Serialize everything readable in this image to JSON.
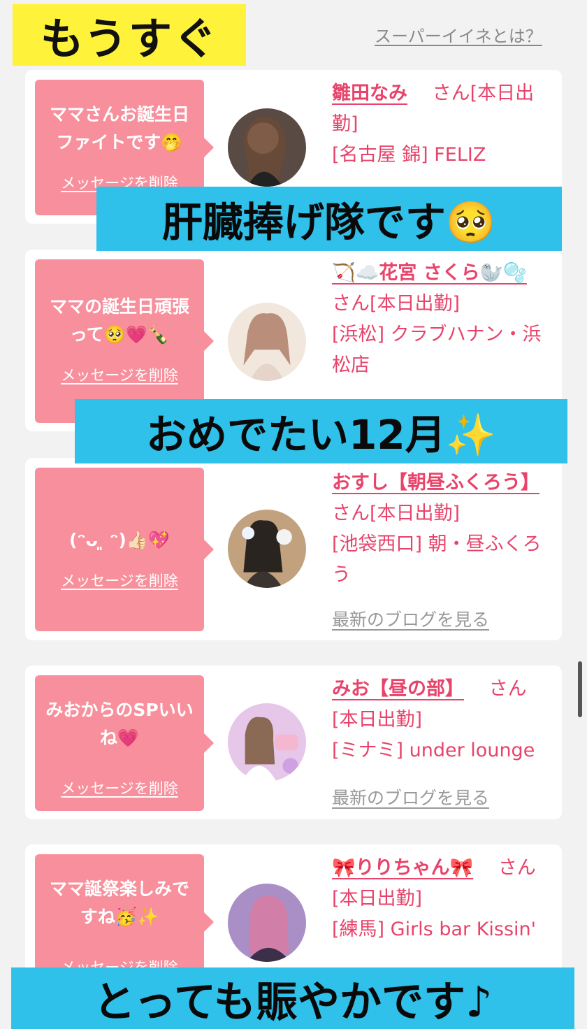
{
  "header": {
    "banner_text": "もうすぐ",
    "super_link": "スーパーイイネとは？"
  },
  "cards": [
    {
      "message": "ママさんお誕生日ファイトです🤭",
      "delete_label": "メッセージを削除",
      "name": "雛田なみ",
      "honorific": "さん",
      "status": "[本日出勤]",
      "location": "[名古屋 錦] FELIZ",
      "blog_label": ""
    },
    {
      "message": "ママの誕生日頑張って🥺💗🍾",
      "delete_label": "メッセージを削除",
      "name": "🏹☁️花宮 さくら🦭🫧",
      "honorific": "さん",
      "status": "[本日出勤]",
      "location": "[浜松] クラブハナン・浜松店",
      "blog_label": ""
    },
    {
      "message": "(ᵔᴗ ͈ ᵔ)👍🏻💖",
      "delete_label": "メッセージを削除",
      "name": "おすし【朝昼ふくろう】",
      "honorific": "さん",
      "status": "[本日出勤]",
      "location": "[池袋西口] 朝・昼ふくろう",
      "blog_label": "最新のブログを見る"
    },
    {
      "message": "みおからのSPいいね💗",
      "delete_label": "メッセージを削除",
      "name": "みお【昼の部】",
      "honorific": "さん",
      "status": "[本日出勤]",
      "location": "[ミナミ] under lounge",
      "blog_label": "最新のブログを見る"
    },
    {
      "message": "ママ誕祭楽しみですね🥳✨",
      "delete_label": "メッセージを削除",
      "name": "🎀りりちゃん🎀",
      "honorific": "さん",
      "status": "[本日出勤]",
      "location": "[練馬] Girls bar Kissin'",
      "blog_label": ""
    }
  ],
  "overlays": {
    "caption1": "肝臓捧げ隊です🥺",
    "caption2": "おめでたい12月✨",
    "caption3": "とっても賑やかです♪"
  },
  "colors": {
    "accent_pink": "#e8436a",
    "bubble_pink": "#f7909c",
    "caption_blue": "#2fc1ea",
    "banner_yellow": "#fff23a"
  }
}
